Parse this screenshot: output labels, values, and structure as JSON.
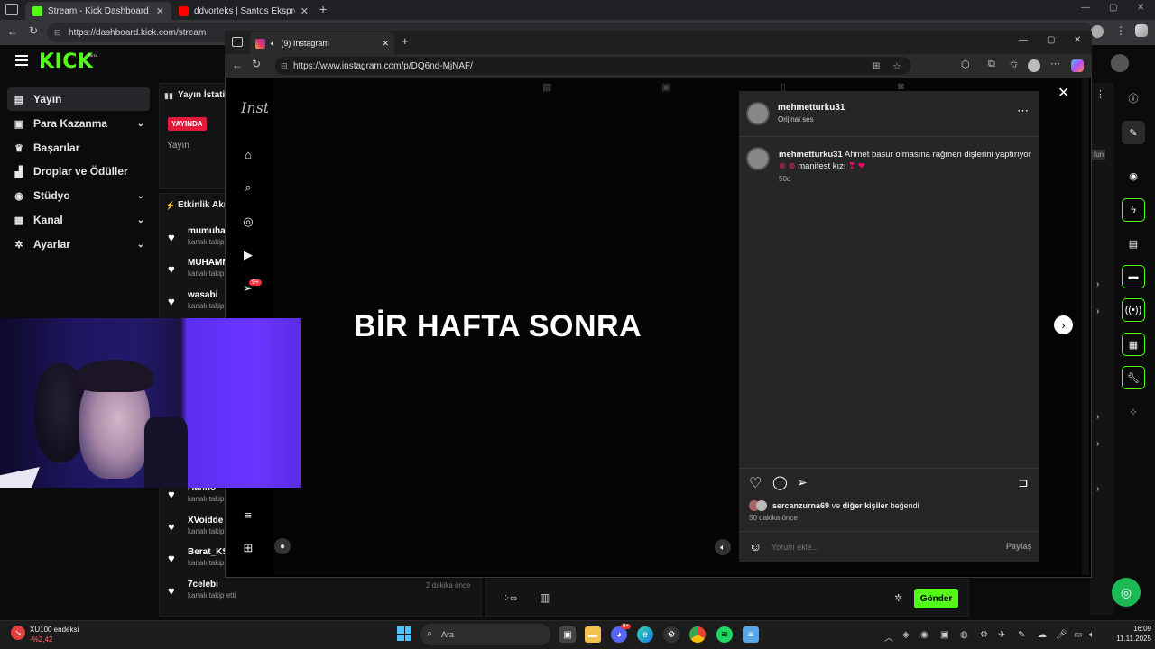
{
  "outer_browser": {
    "tabs": [
      {
        "label": "Stream - Kick Dashboard",
        "active": true
      },
      {
        "label": "ddvorteks | Santos Ekspres [2] - Y",
        "active": false
      }
    ],
    "url": "https://dashboard.kick.com/stream"
  },
  "kick": {
    "logo": "KICK",
    "logo_badge": "BETA",
    "sidebar": [
      {
        "label": "Yayın",
        "icon": "broadcast-icon",
        "active": true
      },
      {
        "label": "Para Kazanma",
        "icon": "money-icon",
        "chevron": true
      },
      {
        "label": "Başarılar",
        "icon": "trophy-icon"
      },
      {
        "label": "Droplar ve Ödüller",
        "icon": "gift-icon"
      },
      {
        "label": "Stüdyo",
        "icon": "studio-icon",
        "chevron": true
      },
      {
        "label": "Kanal",
        "icon": "channel-icon",
        "chevron": true
      },
      {
        "label": "Ayarlar",
        "icon": "settings-icon",
        "chevron": true
      }
    ],
    "stats_title": "Yayın İstatis",
    "live_badge": "YAYINDA",
    "stream_label": "Yayın",
    "activity_title": "Etkinlik Akı",
    "activity": [
      {
        "name": "mumuha",
        "sub": "kanalı takip"
      },
      {
        "name": "MUHAMM",
        "sub": "kanalı takip"
      },
      {
        "name": "wasabi",
        "sub": "kanalı takip"
      },
      {
        "name": "Hanno",
        "sub": "kanalı takip"
      },
      {
        "name": "XVoidde",
        "sub": "kanalı takip"
      },
      {
        "name": "Berat_KS",
        "sub": "kanalı takip"
      },
      {
        "name": "7celebi",
        "sub": "kanalı takip etti"
      }
    ],
    "time_ago": "2 dakika önce",
    "send_button": "Gönder",
    "right_tag": "fun"
  },
  "instagram_window": {
    "tab_label": "(9) Instagram",
    "url": "https://www.instagram.com/p/DQ6nd-MjNAF/",
    "logo_partial": "Insta",
    "notif_badge": "9+",
    "overlay_caption": "BİR HAFTA SONRA",
    "post": {
      "username": "mehmetturku31",
      "audio": "Orijinal ses",
      "caption_user": "mehmetturku31",
      "caption_text": "Ahmet basur olmasına rağmen dişlerini yaptırıyor",
      "caption_line2": "manifest kızı",
      "age": "50d",
      "likes_user": "sercanzurna69",
      "likes_connector": "ve",
      "likes_others": "diğer kişiler",
      "likes_suffix": "beğendi",
      "time": "50 dakika önce",
      "comment_placeholder": "Yorum ekle...",
      "share_button": "Paylaş"
    }
  },
  "taskbar": {
    "weather_title": "XU100 endeksi",
    "weather_value": "-%2,42",
    "search_placeholder": "Ara",
    "time": "16:09",
    "date": "11.11.2025",
    "discord_badge": "9+"
  },
  "colors": {
    "kick_green": "#53fc18",
    "live_red": "#e21a3a"
  }
}
